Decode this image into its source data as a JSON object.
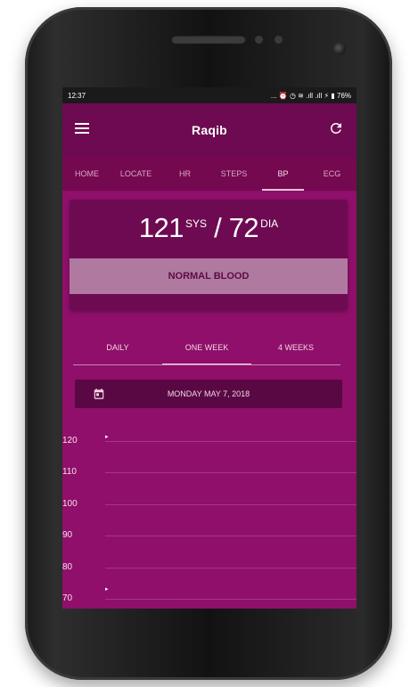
{
  "status_bar": {
    "time": "12:37",
    "icons": "... ⏰ ◷ ≋ .ıll .ıll ⚡ ▮ 76%"
  },
  "toolbar": {
    "title": "Raqib",
    "menu_icon": "hamburger-icon",
    "refresh_icon": "refresh-icon"
  },
  "tabs": [
    {
      "label": "HOME"
    },
    {
      "label": "LOCATE"
    },
    {
      "label": "HR"
    },
    {
      "label": "STEPS"
    },
    {
      "label": "BP",
      "active": true
    },
    {
      "label": "ECG"
    }
  ],
  "bp": {
    "systolic": "121",
    "sys_label": "SYS",
    "separator": "/",
    "diastolic": "72",
    "dia_label": "DIA",
    "status": "NORMAL BLOOD"
  },
  "range_tabs": [
    {
      "label": "DAILY"
    },
    {
      "label": "ONE WEEK",
      "active": true
    },
    {
      "label": "4 WEEKS"
    }
  ],
  "date_bar": {
    "date": "MONDAY MAY 7, 2018",
    "icon": "calendar-icon"
  },
  "chart_data": {
    "type": "line",
    "y_ticks": [
      "120",
      "110",
      "100",
      "90",
      "80",
      "70"
    ],
    "ylim": [
      70,
      120
    ],
    "grid": true
  },
  "colors": {
    "accent": "#8c0d68",
    "toolbar": "#6e0a52",
    "status_banner": "#b07aa0"
  }
}
